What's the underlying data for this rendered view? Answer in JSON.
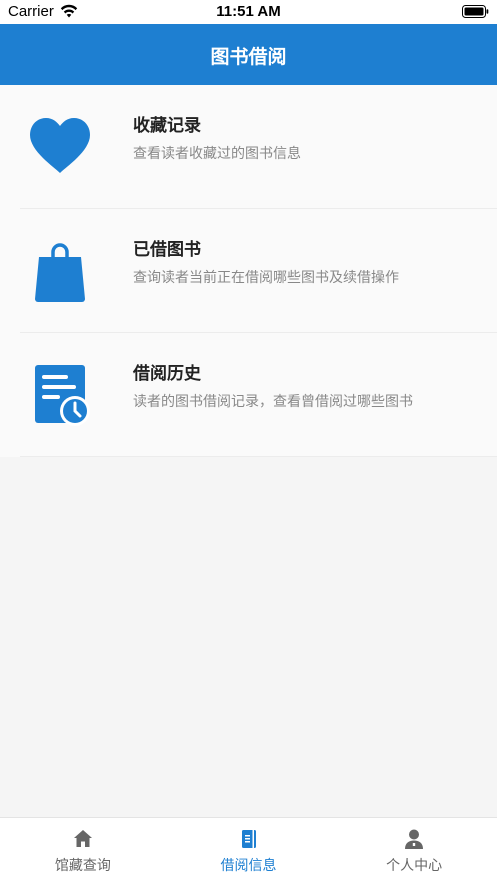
{
  "status_bar": {
    "carrier": "Carrier",
    "time": "11:51 AM"
  },
  "nav": {
    "title": "图书借阅"
  },
  "colors": {
    "primary": "#1e7fd1",
    "icon": "#1e7fd1"
  },
  "items": [
    {
      "icon": "heart-icon",
      "title": "收藏记录",
      "desc": "查看读者收藏过的图书信息"
    },
    {
      "icon": "shopping-bag-icon",
      "title": "已借图书",
      "desc": "查询读者当前正在借阅哪些图书及续借操作"
    },
    {
      "icon": "history-document-icon",
      "title": "借阅历史",
      "desc": "读者的图书借阅记录，查看曾借阅过哪些图书"
    }
  ],
  "tabs": [
    {
      "icon": "home-icon",
      "label": "馆藏查询",
      "active": false
    },
    {
      "icon": "book-icon",
      "label": "借阅信息",
      "active": true
    },
    {
      "icon": "person-icon",
      "label": "个人中心",
      "active": false
    }
  ]
}
